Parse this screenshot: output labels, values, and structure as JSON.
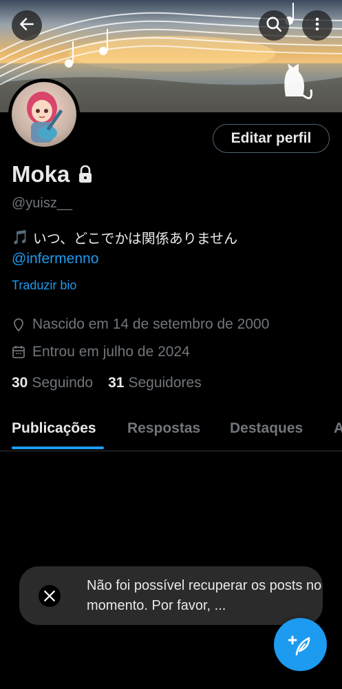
{
  "header": {
    "back_icon": "arrow-left-icon",
    "search_icon": "search-icon",
    "more_icon": "more-vertical-icon"
  },
  "profile": {
    "edit_label": "Editar perfil",
    "name": "Moka",
    "lock_icon": "lock-icon",
    "handle": "@yuisz__",
    "bio_emoji": "🎵",
    "bio_text": "いつ、どこでかは関係ありません",
    "bio_mention": "@infermenno",
    "translate_label": "Traduzir bio",
    "birth": "Nascido em 14 de setembro de 2000",
    "joined": "Entrou em julho de 2024",
    "following_count": "30",
    "following_label": "Seguindo",
    "followers_count": "31",
    "followers_label": "Seguidores"
  },
  "tabs": [
    {
      "label": "Publicações",
      "active": true
    },
    {
      "label": "Respostas",
      "active": false
    },
    {
      "label": "Destaques",
      "active": false
    },
    {
      "label": "A",
      "active": false
    }
  ],
  "toast": {
    "text": "Não foi possível recuperar os posts no momento. Por favor, ..."
  },
  "colors": {
    "accent": "#1d9bf0",
    "background": "#000000",
    "muted_text": "#71767b",
    "primary_text": "#e7e9ea"
  }
}
